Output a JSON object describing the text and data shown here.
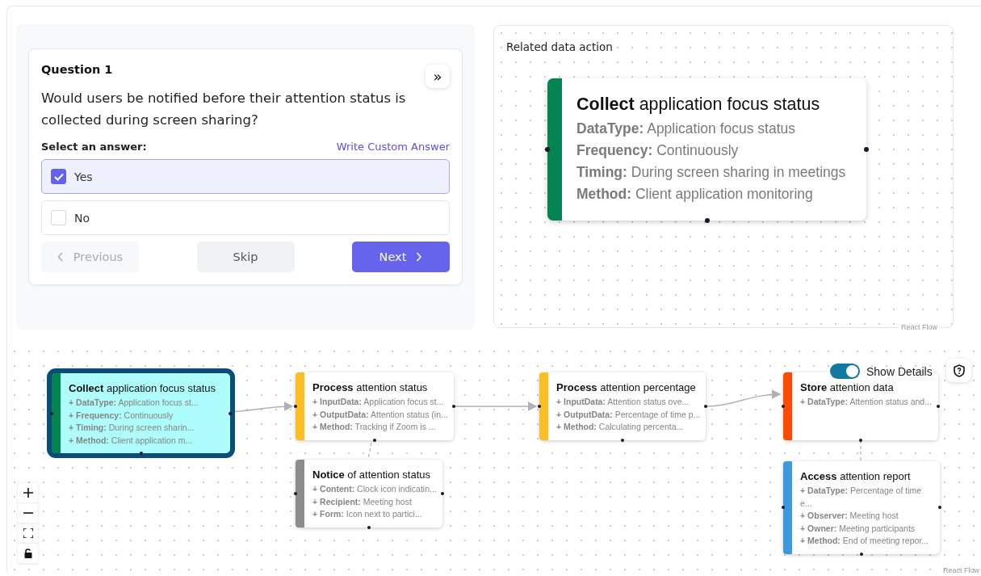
{
  "quiz": {
    "title": "Question 1",
    "expand_button": "»",
    "question": "Would users be notified before their attention status is collected during screen sharing?",
    "prompt": "Select an answer:",
    "custom_link": "Write Custom Answer",
    "options": [
      {
        "label": "Yes",
        "checked": true
      },
      {
        "label": "No",
        "checked": false
      }
    ],
    "buttons": [
      {
        "label": "Previous",
        "kind": "previous",
        "disabled": true
      },
      {
        "label": "Skip",
        "kind": "skip",
        "disabled": false
      },
      {
        "label": "Next",
        "kind": "next",
        "disabled": false
      }
    ]
  },
  "related": {
    "title": "Related data action",
    "attribution": "React Flow",
    "node": {
      "title": "**Collect** application focus status",
      "color": "#038450",
      "fields": [
        "**DataType:** Application focus status",
        "**Frequency:** Continuously",
        "**Timing:** During screen sharing in meetings",
        "**Method:** Client application monitoring"
      ]
    }
  },
  "flow": {
    "show_details": {
      "label": "Show Details",
      "on": true
    },
    "attribution": "React Flow",
    "nodes": [
      {
        "title": "**Collect** application focus status",
        "color": "#038450",
        "selected": true,
        "fields": [
          "**+ DataType:** Application focus st...",
          "**+ Frequency:** Continuously",
          "**+ Timing:** During screen sharin...",
          "**+ Method:** Client application m..."
        ]
      },
      {
        "title": "**Process** attention status",
        "color": "#fbbf24",
        "selected": false,
        "fields": [
          "**+ InputData:** Application focus st...",
          "**+ OutputData:** Attention status (in...",
          "**+ Method:** Tracking if Zoom is ..."
        ]
      },
      {
        "title": "**Notice** of attention status",
        "color": "#8c8c8c",
        "selected": false,
        "fields": [
          "**+ Content:** Clock icon indicatin...",
          "**+ Recipient:** Meeting host",
          "**+ Form:** Icon next to partici..."
        ]
      },
      {
        "title": "**Process** attention percentage",
        "color": "#fbbf24",
        "selected": false,
        "fields": [
          "**+ InputData:** Attention status ove...",
          "**+ OutputData:** Percentage of time p...",
          "**+ Method:** Calculating percenta..."
        ]
      },
      {
        "title": "**Store** attention data",
        "color": "#ff4a00",
        "selected": false,
        "fields": [
          "**+ DataType:** Attention status and..."
        ]
      },
      {
        "title": "**Access** attention report",
        "color": "#3b99dc",
        "selected": false,
        "fields": [
          "**+ DataType:** Percentage of time e...",
          "**+ Observer:** Meeting host",
          "**+ Owner:** Meeting participants",
          "**+ Method:** End of meeting repor..."
        ]
      }
    ]
  }
}
